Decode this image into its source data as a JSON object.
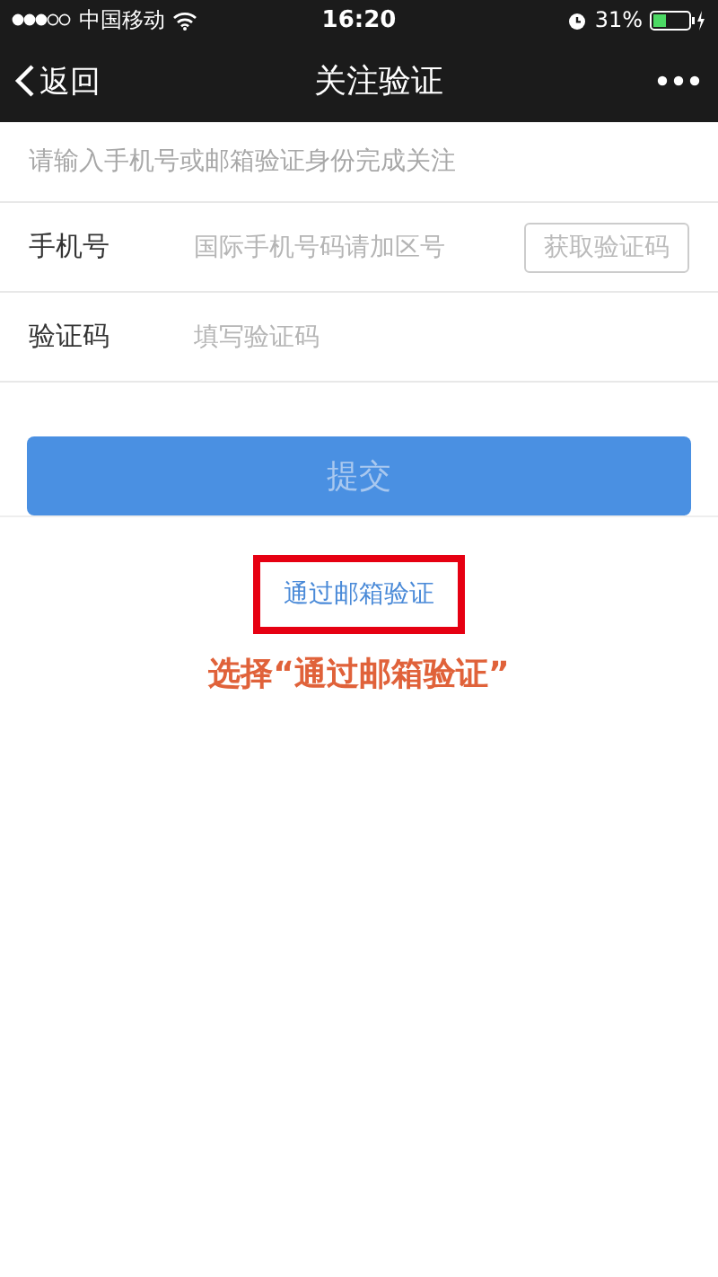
{
  "status_bar": {
    "carrier": "中国移动",
    "time": "16:20",
    "battery": "31%"
  },
  "nav": {
    "back": "返回",
    "title": "关注验证"
  },
  "hint": "请输入手机号或邮箱验证身份完成关注",
  "fields": [
    {
      "label": "手机号",
      "placeholder": "国际手机号码请加区号",
      "button": "获取验证码"
    },
    {
      "label": "验证码",
      "placeholder": "填写验证码"
    }
  ],
  "submit": {
    "label": "提交",
    "disabled": true
  },
  "email_link": "通过邮箱验证",
  "annotation": "选择“通过邮箱验证”"
}
